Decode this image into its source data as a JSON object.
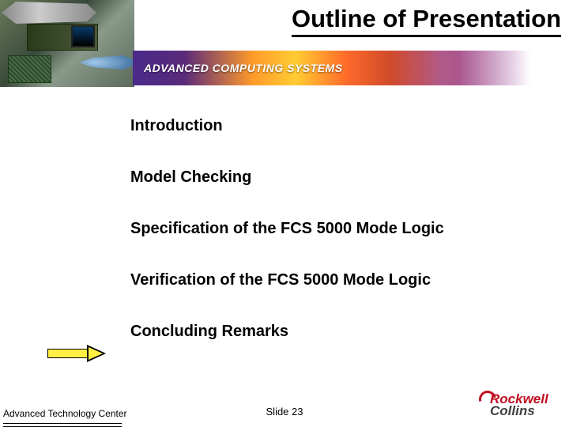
{
  "title": "Outline of Presentation",
  "banner": {
    "text": "ADVANCED COMPUTING SYSTEMS"
  },
  "outline": {
    "items": [
      "Introduction",
      "Model Checking",
      "Specification of the FCS 5000 Mode Logic",
      "Verification of the FCS 5000 Mode Logic",
      "Concluding Remarks"
    ],
    "pointer_index": 4
  },
  "footer": {
    "left": "Advanced Technology Center",
    "center": "Slide 23",
    "company_top": "Rockwell",
    "company_bottom": "Collins"
  }
}
